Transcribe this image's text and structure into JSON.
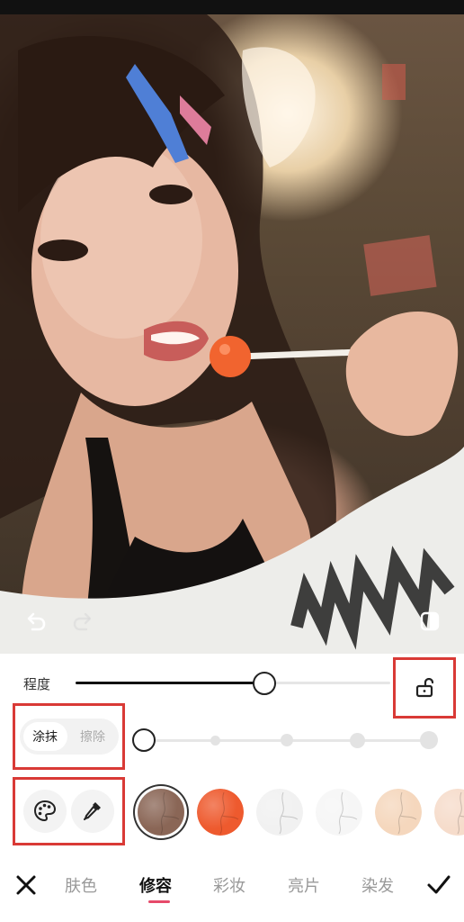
{
  "photo": {
    "undo_icon": "undo-icon",
    "redo_icon": "redo-icon",
    "compare_icon": "compare-icon"
  },
  "degree": {
    "label": "程度",
    "value": 0.6
  },
  "mode": {
    "paint_label": "涂抹",
    "erase_label": "擦除",
    "active": "涂抹"
  },
  "brush_size": {
    "levels": 5,
    "selected_index": 0
  },
  "tools": {
    "palette_icon": "palette-icon",
    "eyedropper_icon": "eyedropper-icon"
  },
  "swatches": [
    {
      "color": "#8a6656",
      "selected": true
    },
    {
      "color": "#ee5a2e",
      "selected": false
    },
    {
      "color": "#f1f1f1",
      "selected": false
    },
    {
      "color": "#f6f6f6",
      "selected": false
    },
    {
      "color": "#f5d7bd",
      "selected": false
    },
    {
      "color": "#f6dccb",
      "selected": false
    }
  ],
  "nav": {
    "close_icon": "close-icon",
    "confirm_icon": "check-icon",
    "tabs": [
      "肤色",
      "修容",
      "彩妆",
      "亮片",
      "染发"
    ],
    "active_tab": "修容"
  },
  "colors": {
    "highlight_border": "#d93a36",
    "tab_underline": "#e64a6a"
  }
}
